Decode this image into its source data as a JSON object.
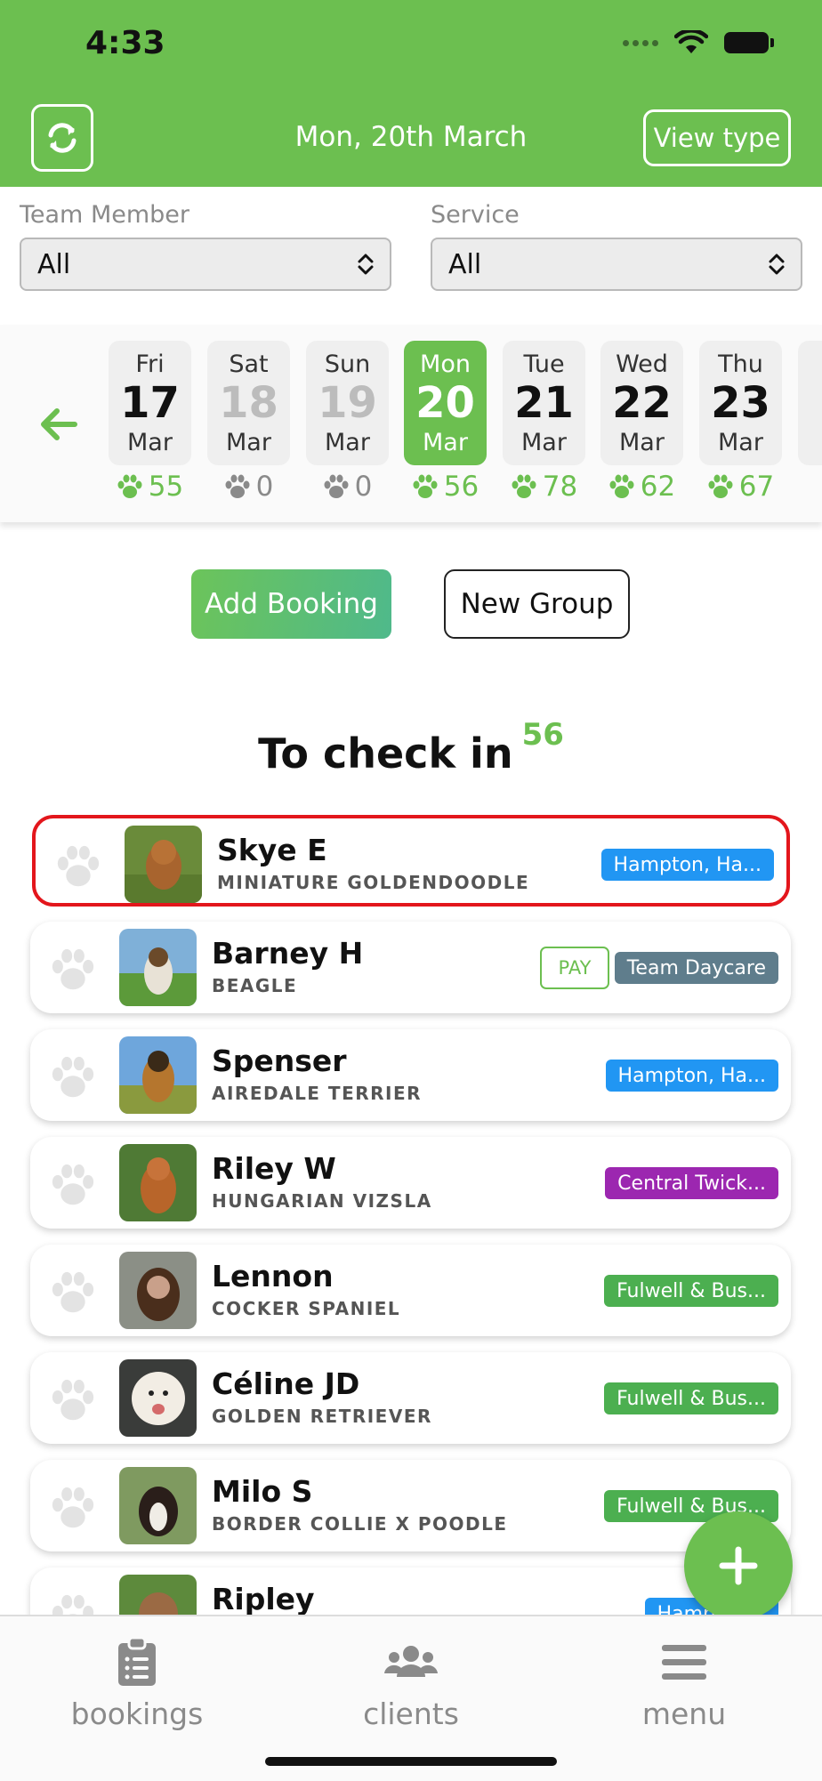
{
  "status_bar": {
    "time": "4:33"
  },
  "header": {
    "date": "Mon, 20th March",
    "view_type_label": "View type",
    "bg_color": "#6cbf50"
  },
  "filters": {
    "team_member": {
      "label": "Team Member",
      "value": "All"
    },
    "service": {
      "label": "Service",
      "value": "All"
    }
  },
  "days": [
    {
      "name": "Fri",
      "num": "17",
      "month": "Mar",
      "count": "55"
    },
    {
      "name": "Sat",
      "num": "18",
      "month": "Mar",
      "count": "0"
    },
    {
      "name": "Sun",
      "num": "19",
      "month": "Mar",
      "count": "0"
    },
    {
      "name": "Mon",
      "num": "20",
      "month": "Mar",
      "count": "56"
    },
    {
      "name": "Tue",
      "num": "21",
      "month": "Mar",
      "count": "78"
    },
    {
      "name": "Wed",
      "num": "22",
      "month": "Mar",
      "count": "62"
    },
    {
      "name": "Thu",
      "num": "23",
      "month": "Mar",
      "count": "67"
    }
  ],
  "actions": {
    "add_booking": "Add Booking",
    "new_group": "New Group"
  },
  "section": {
    "title": "To check in",
    "count": "56"
  },
  "bookings": [
    {
      "name": "Skye E",
      "breed": "MINIATURE GOLDENDOODLE",
      "tag": "Hampton, Ha...",
      "tag_color": "#2196f3"
    },
    {
      "name": "Barney H",
      "breed": "BEAGLE",
      "pay": "PAY",
      "tag": "Team Daycare",
      "tag_color": "#5f7d8c"
    },
    {
      "name": "Spenser",
      "breed": "AIREDALE TERRIER",
      "tag": "Hampton, Ha...",
      "tag_color": "#2196f3"
    },
    {
      "name": "Riley W",
      "breed": "HUNGARIAN VIZSLA",
      "tag": "Central Twick...",
      "tag_color": "#9c27b0"
    },
    {
      "name": "Lennon",
      "breed": "COCKER SPANIEL",
      "tag": "Fulwell & Bus...",
      "tag_color": "#4caf50"
    },
    {
      "name": "Céline JD",
      "breed": "GOLDEN RETRIEVER",
      "tag": "Fulwell & Bus...",
      "tag_color": "#4caf50"
    },
    {
      "name": "Milo S",
      "breed": "BORDER COLLIE X POODLE",
      "tag": "Fulwell & Bus...",
      "tag_color": "#4caf50"
    },
    {
      "name": "Ripley",
      "breed": "",
      "tag": "Hampton...",
      "tag_color": "#2196f3"
    }
  ],
  "nav": {
    "bookings": "bookings",
    "clients": "clients",
    "menu": "menu"
  }
}
